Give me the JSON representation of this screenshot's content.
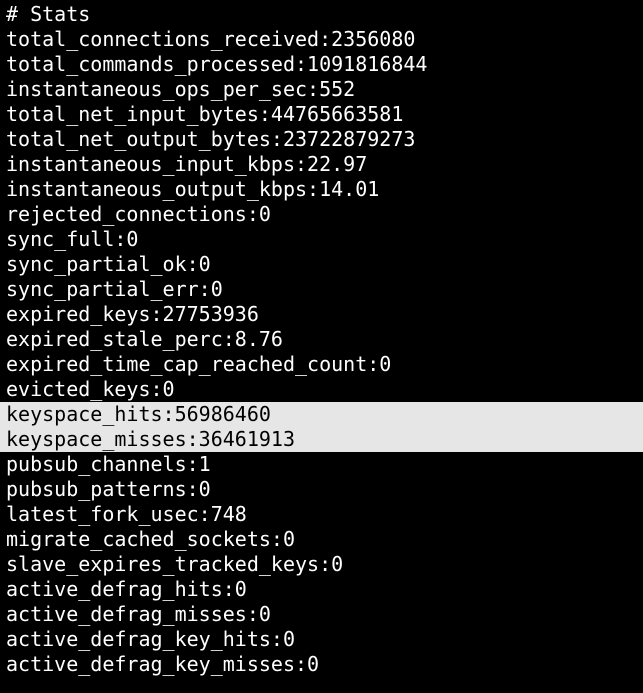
{
  "terminal": {
    "lines": [
      "# Stats",
      "total_connections_received:2356080",
      "total_commands_processed:1091816844",
      "instantaneous_ops_per_sec:552",
      "total_net_input_bytes:44765663581",
      "total_net_output_bytes:23722879273",
      "instantaneous_input_kbps:22.97",
      "instantaneous_output_kbps:14.01",
      "rejected_connections:0",
      "sync_full:0",
      "sync_partial_ok:0",
      "sync_partial_err:0",
      "expired_keys:27753936",
      "expired_stale_perc:8.76",
      "expired_time_cap_reached_count:0",
      "evicted_keys:0",
      "keyspace_hits:56986460",
      "keyspace_misses:36461913",
      "pubsub_channels:1",
      "pubsub_patterns:0",
      "latest_fork_usec:748",
      "migrate_cached_sockets:0",
      "slave_expires_tracked_keys:0",
      "active_defrag_hits:0",
      "active_defrag_misses:0",
      "active_defrag_key_hits:0",
      "active_defrag_key_misses:0"
    ],
    "selected_lines": [
      16,
      17
    ]
  },
  "colors": {
    "background": "#000000",
    "text": "#ffffff",
    "selection_background": "#e6e6e6",
    "selection_text": "#000000"
  }
}
